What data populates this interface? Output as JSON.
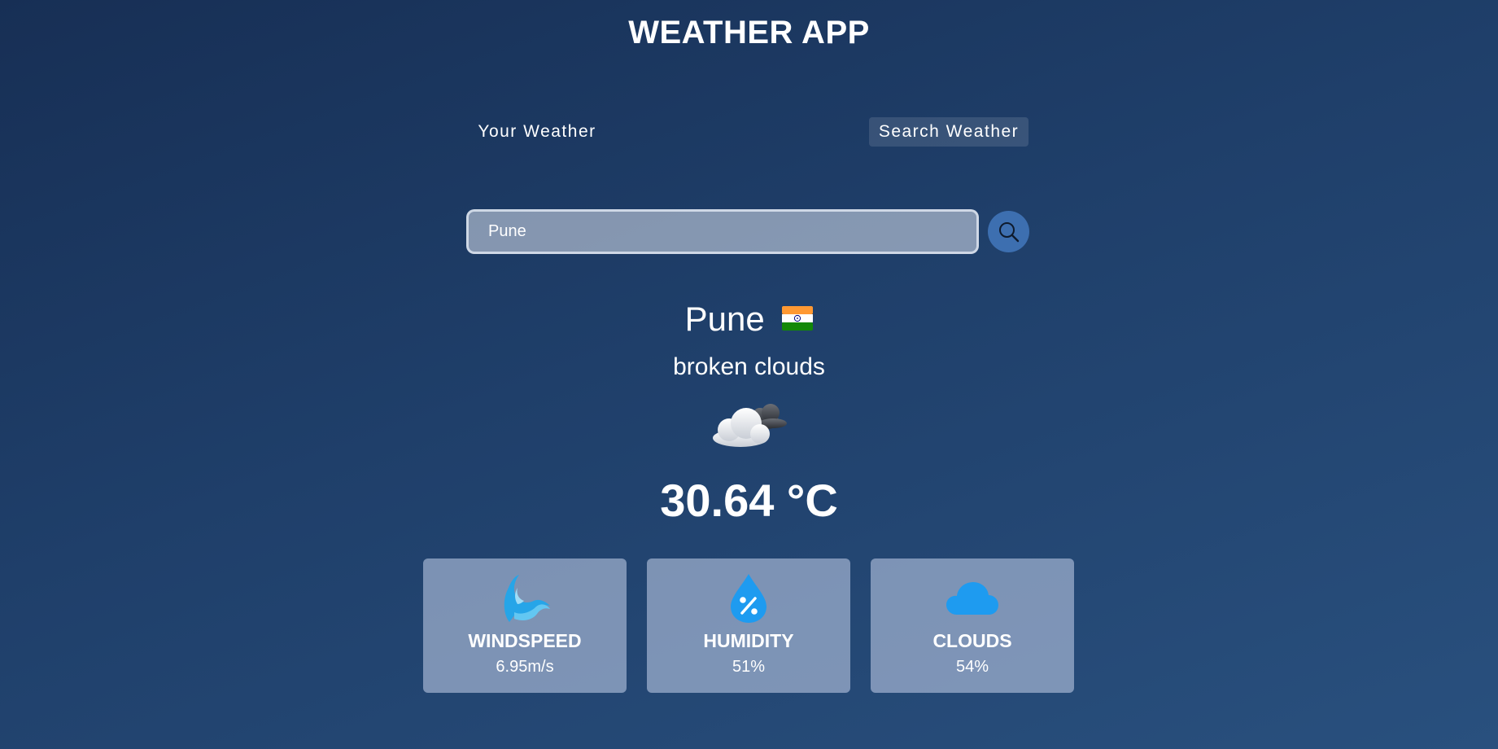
{
  "header": {
    "title": "WEATHER APP"
  },
  "tabs": [
    {
      "label": "Your Weather",
      "active": false
    },
    {
      "label": "Search Weather",
      "active": true
    }
  ],
  "search": {
    "value": "Pune",
    "placeholder": "",
    "button_icon": "search-icon"
  },
  "weather": {
    "city": "Pune",
    "country_flag": "india-flag-icon",
    "condition": "broken clouds",
    "condition_icon": "broken-clouds-icon",
    "temperature": "30.64 °C"
  },
  "stats": [
    {
      "label": "WINDSPEED",
      "value": "6.95m/s",
      "icon": "wind-icon"
    },
    {
      "label": "HUMIDITY",
      "value": "51%",
      "icon": "humidity-icon"
    },
    {
      "label": "CLOUDS",
      "value": "54%",
      "icon": "cloud-icon"
    }
  ],
  "colors": {
    "background_start": "#172f55",
    "background_end": "#29507e",
    "accent_blue": "#3d6fb0",
    "icon_blue": "#1e9bf0"
  }
}
